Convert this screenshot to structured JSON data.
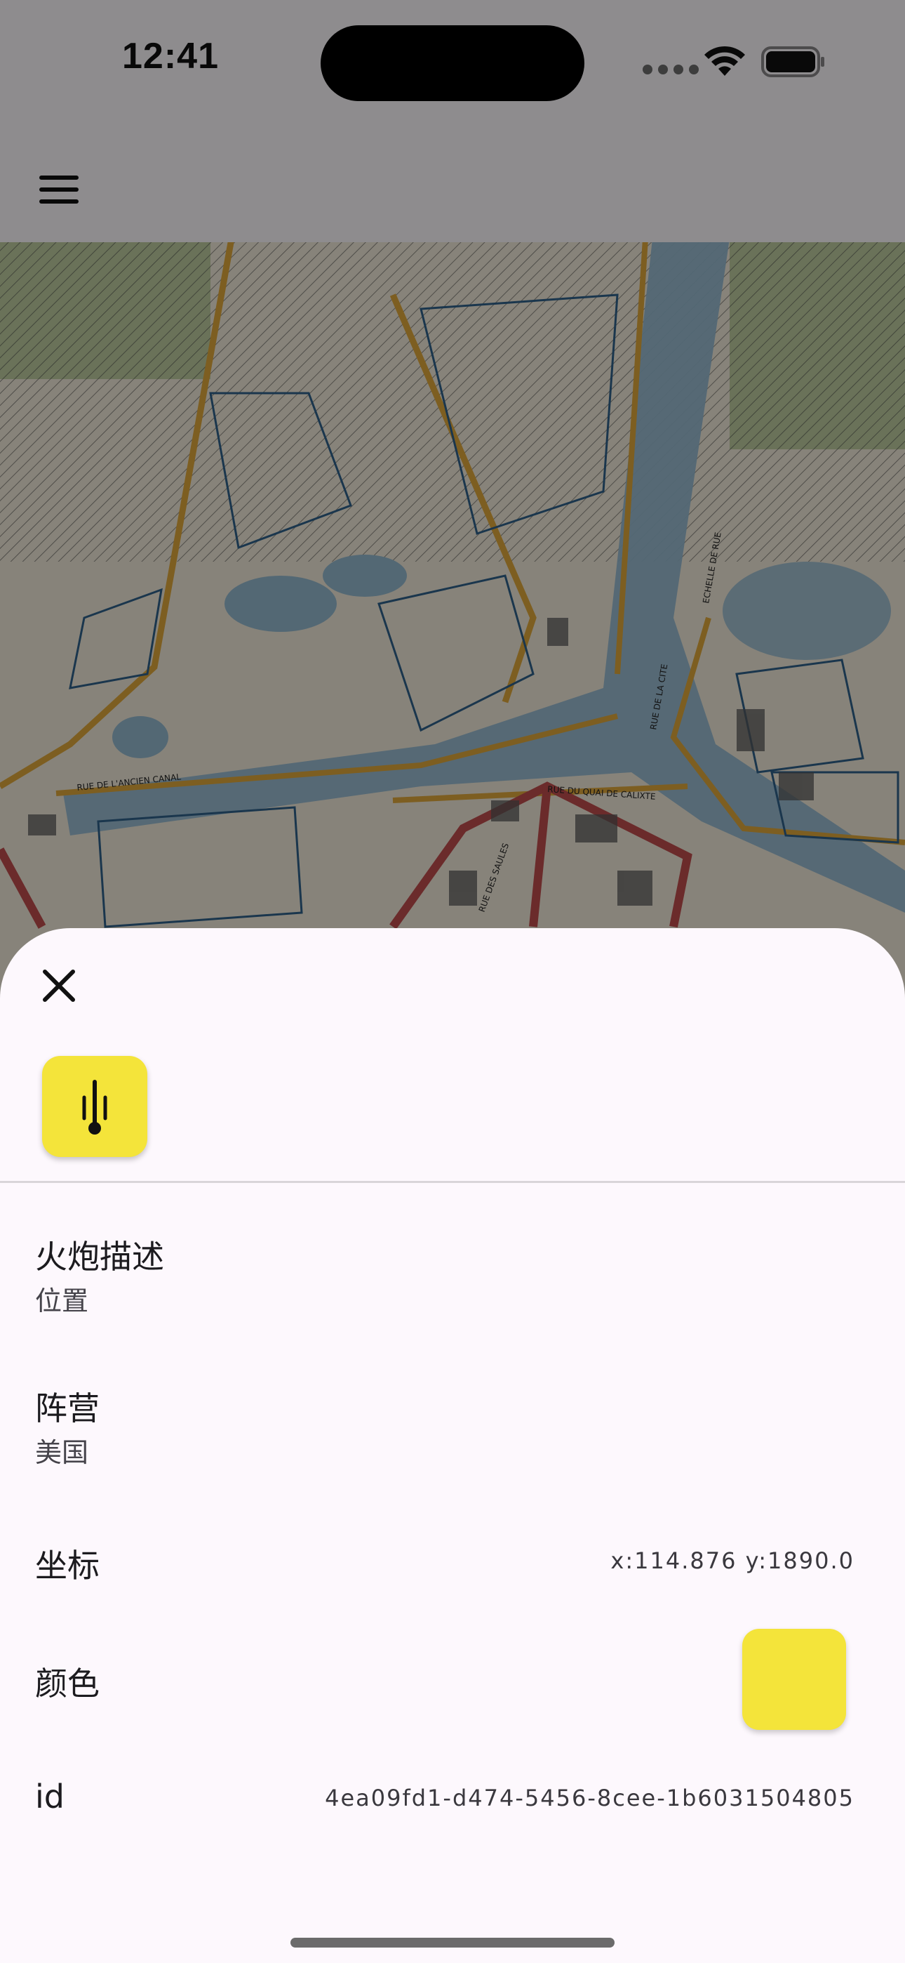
{
  "status_bar": {
    "time": "12:41"
  },
  "app_bar": {
    "menu_icon": "hamburger-menu-icon"
  },
  "map": {
    "street_labels": [
      "RUE DE L'ANCIEN CANAL",
      "RUE DU QUAI DE CALIXTE",
      "RUE DE LA CITE",
      "ECHELLE DE RUE",
      "RUE DES SAULES"
    ]
  },
  "sheet": {
    "close_icon": "close-icon",
    "marker_icon": "artillery-marker-icon",
    "marker_color": "#f4e43a",
    "fields": {
      "description": {
        "title": "火炮描述",
        "value": "位置"
      },
      "faction": {
        "title": "阵营",
        "value": "美国"
      },
      "coordinates": {
        "title": "坐标",
        "value": "x:114.876 y:1890.0"
      },
      "color": {
        "title": "颜色",
        "value": "#f4e43a"
      },
      "id": {
        "title": "id",
        "value": "4ea09fd1-d474-5456-8cee-1b6031504805"
      }
    }
  }
}
